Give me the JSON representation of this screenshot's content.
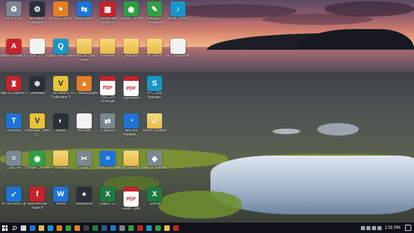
{
  "desktop": {
    "icons": [
      {
        "label": "Recycle Bin",
        "glyph": "♻",
        "style": "gray",
        "icon": "recycle-bin-icon"
      },
      {
        "label": "Sid Meier's Civilization V",
        "glyph": "⚙",
        "style": "dark",
        "icon": "civilization-icon"
      },
      {
        "label": "Mozilla Firefox",
        "glyph": "●",
        "style": "orange",
        "icon": "firefox-icon"
      },
      {
        "label": "TeamViewer 9",
        "glyph": "⇆",
        "style": "blue",
        "icon": "teamviewer-icon"
      },
      {
        "label": "Chrome App Launcher",
        "glyph": "▦",
        "style": "red",
        "icon": "chrome-app-launcher-icon"
      },
      {
        "label": "Google Chrome",
        "glyph": "◉",
        "style": "green",
        "icon": "chrome-icon"
      },
      {
        "label": "notepad++ Shortcut",
        "glyph": "✎",
        "style": "green",
        "icon": "notepad-plus-plus-icon"
      },
      {
        "label": "Music Library",
        "glyph": "♪",
        "style": "teal",
        "icon": "music-library-icon"
      },
      {
        "label": "Adobe Reader XI",
        "glyph": "A",
        "style": "red",
        "icon": "adobe-reader-icon"
      },
      {
        "label": "Scan_2015",
        "glyph": "",
        "style": "doc",
        "icon": "document-icon"
      },
      {
        "label": "QuickTime Player",
        "glyph": "Q",
        "style": "teal",
        "icon": "quicktime-icon"
      },
      {
        "label": "ProtoLab Shell Game",
        "glyph": "",
        "style": "folder",
        "icon": "folder-icon"
      },
      {
        "label": "traverbfile",
        "glyph": "",
        "style": "folder",
        "icon": "zip-folder-icon"
      },
      {
        "label": "CertificateS",
        "glyph": "",
        "style": "folder",
        "icon": "folder-icon"
      },
      {
        "label": "My Videos",
        "glyph": "",
        "style": "folder",
        "icon": "videos-folder-icon"
      },
      {
        "label": "My Documents",
        "glyph": "",
        "style": "doc",
        "icon": "my-documents-icon"
      },
      {
        "label": "Age of Empires II",
        "glyph": "♜",
        "style": "red",
        "icon": "age-of-empires-icon"
      },
      {
        "label": "Snowflake",
        "glyph": "❄",
        "style": "dark",
        "icon": "snowflake-icon"
      },
      {
        "label": "Sid Meier's Civilization V",
        "glyph": "V",
        "style": "yellowv",
        "icon": "civilization-v-icon"
      },
      {
        "label": "VLC media player",
        "glyph": "▲",
        "style": "orange",
        "icon": "vlc-icon"
      },
      {
        "label": "1099_DIV 2014.pdf",
        "glyph": "PDF",
        "style": "pdf",
        "icon": "pdf-file-icon"
      },
      {
        "label": "Dependent",
        "glyph": "PDF",
        "style": "pdf",
        "icon": "pdf-file-icon"
      },
      {
        "label": "HTC Sync Manager",
        "glyph": "S",
        "style": "teal",
        "icon": "htc-sync-icon"
      },
      {
        "label": "Teleworks",
        "glyph": "T",
        "style": "blue",
        "icon": "teleworks-icon"
      },
      {
        "label": "Freemake Video C...",
        "glyph": "V",
        "style": "yellowv",
        "icon": "freemake-icon"
      },
      {
        "label": "Steam",
        "glyph": "◐",
        "style": "dark",
        "icon": "steam-icon"
      },
      {
        "label": "test.blah",
        "glyph": "",
        "style": "doc",
        "icon": "file-icon"
      },
      {
        "label": "nLdag.ica",
        "glyph": "⇄",
        "style": "gray",
        "icon": "ica-file-icon"
      },
      {
        "label": "MiniTool Partition...",
        "glyph": "◔",
        "style": "blue",
        "icon": "minitool-icon"
      },
      {
        "label": "Norton Installer",
        "glyph": "✓",
        "style": "folder",
        "icon": "norton-icon"
      },
      {
        "label": "CopyDisk",
        "glyph": "≡",
        "style": "gray",
        "icon": "copydisk-icon"
      },
      {
        "label": "Google Chrome",
        "glyph": "◉",
        "style": "green",
        "icon": "chrome-icon"
      },
      {
        "label": "Tortoise",
        "glyph": "",
        "style": "folder",
        "icon": "folder-icon"
      },
      {
        "label": "Eklip",
        "glyph": "✂",
        "style": "gray",
        "icon": "eklip-icon"
      },
      {
        "label": "Screen Recorder",
        "glyph": "≈",
        "style": "blue",
        "icon": "screen-recorder-icon"
      },
      {
        "label": "My Pictures",
        "glyph": "",
        "style": "folder",
        "icon": "pictures-folder-icon"
      },
      {
        "label": "MinGW Installer",
        "glyph": "◆",
        "style": "gray",
        "icon": "mingw-installer-icon"
      },
      {
        "label": "ATIVA tunes Up",
        "glyph": "✓",
        "style": "blue",
        "icon": "ativa-icon"
      },
      {
        "label": "Macromedia Flash 8",
        "glyph": "f",
        "style": "red",
        "icon": "flash-icon"
      },
      {
        "label": "Voobix",
        "glyph": "W",
        "style": "blue",
        "icon": "voobix-icon"
      },
      {
        "label": "rollbakcore",
        "glyph": "●",
        "style": "dark",
        "icon": "rollbakcore-icon"
      },
      {
        "label": "Kopies TD",
        "glyph": "X",
        "style": "excel",
        "icon": "excel-file-icon"
      },
      {
        "label": "Exam 1.pdf",
        "glyph": "PDF",
        "style": "pdf",
        "icon": "pdf-file-icon"
      },
      {
        "label": "Sorted",
        "glyph": "X",
        "style": "excel",
        "icon": "excel-file-icon"
      }
    ]
  },
  "taskbar": {
    "pinned": [
      {
        "name": "task-view-icon",
        "color": "#cfd6dd"
      },
      {
        "name": "edge-icon",
        "color": "#1e74d6"
      },
      {
        "name": "file-explorer-icon",
        "color": "#e7b948"
      },
      {
        "name": "store-icon",
        "color": "#1697c8"
      },
      {
        "name": "firefox-icon",
        "color": "#e67e22"
      },
      {
        "name": "chrome-icon",
        "color": "#2f9e44"
      },
      {
        "name": "vlc-icon",
        "color": "#e67e22"
      },
      {
        "name": "steam-icon",
        "color": "#3a3f4a"
      },
      {
        "name": "excel-icon",
        "color": "#1f7a3f"
      },
      {
        "name": "word-icon",
        "color": "#2b5797"
      },
      {
        "name": "teamviewer-icon",
        "color": "#1e74d6"
      },
      {
        "name": "civilization-icon",
        "color": "#7b8791"
      },
      {
        "name": "notepad-icon",
        "color": "#2f9e44"
      },
      {
        "name": "acrobat-icon",
        "color": "#c4242b"
      },
      {
        "name": "skype-icon",
        "color": "#1697c8"
      },
      {
        "name": "android-studio-icon",
        "color": "#2f9e44"
      },
      {
        "name": "folder-icon",
        "color": "#e7b948"
      },
      {
        "name": "media-icon",
        "color": "#c4242b"
      }
    ],
    "clock": "1:31 PM"
  }
}
